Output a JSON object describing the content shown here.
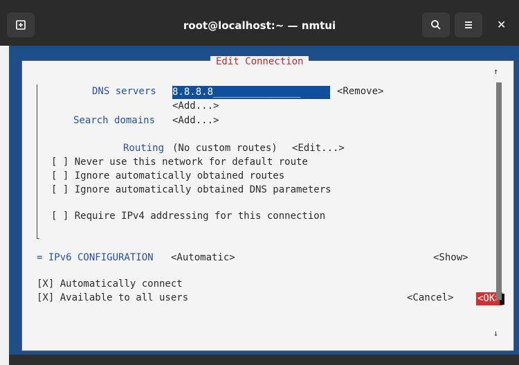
{
  "window": {
    "title": "root@localhost:~ — nmtui"
  },
  "icons": {
    "new_tab": "new-tab-icon",
    "search": "search-icon",
    "menu": "hamburger-menu-icon",
    "close": "close-icon",
    "scroll_up": "arrow-up-icon",
    "scroll_down": "arrow-down-icon"
  },
  "dialog": {
    "title": "Edit Connection",
    "dns_label": "DNS servers",
    "dns_value": "8.8.8.8_______________",
    "remove_label": "<Remove>",
    "dns_add_label": "<Add...>",
    "search_domains_label": "Search domains",
    "search_add_label": "<Add...>",
    "routing_label": "Routing",
    "routing_value": "(No custom routes)",
    "routing_edit": "<Edit...>",
    "checks": [
      "[ ] Never use this network for default route",
      "[ ] Ignore automatically obtained routes",
      "[ ] Ignore automatically obtained DNS parameters",
      "[ ] Require IPv4 addressing for this connection"
    ],
    "ipv6_label": "= IPv6 CONFIGURATION",
    "ipv6_value": "<Automatic>",
    "ipv6_show": "<Show>",
    "auto_connect": "[X] Automatically connect",
    "all_users": "[X] Available to all users",
    "cancel_label": "<Cancel>",
    "ok_label": "<OK>"
  }
}
